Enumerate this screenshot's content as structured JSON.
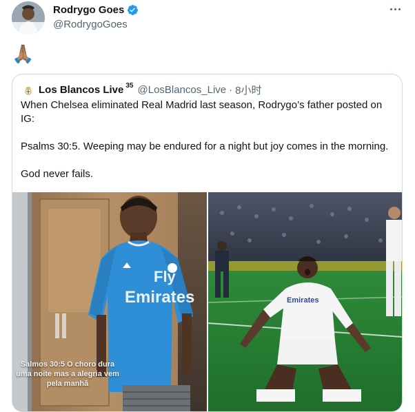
{
  "tweet": {
    "author_name": "Rodrygo Goes",
    "author_handle": "@RodrygoGoes",
    "text": "🙏🏽"
  },
  "icons": {
    "more": "more-horizontal-icon",
    "verified": "verified-badge-icon",
    "quote_account": "crest-icon"
  },
  "colors": {
    "verified": "#1d9bf0",
    "secondary_text": "#536471",
    "border": "#cfd9de"
  },
  "quote": {
    "name": "Los Blancos Live",
    "superscript": "35",
    "handle": "@LosBlancos_Live",
    "separator": "·",
    "time": "8小时",
    "paragraphs": [
      "When Chelsea eliminated Real Madrid last season, Rodrygo’s father posted on IG:",
      "Psalms 30:5. Weeping may be endured for a night but joy comes in the morning.",
      "God never fails."
    ],
    "left_image_caption": "Salmos 30:5 O choro dura uma noite mas a alegria vem pela manhã",
    "jersey_text": [
      "Fly",
      "Emirates"
    ]
  }
}
